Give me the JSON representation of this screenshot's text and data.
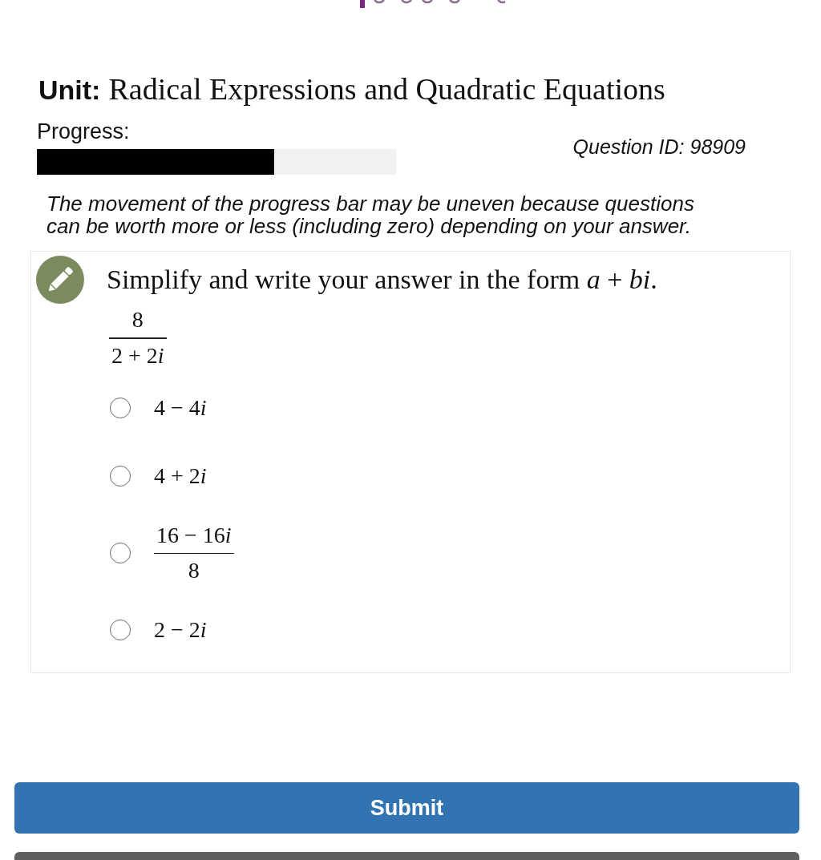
{
  "unit": {
    "label": "Unit:",
    "title": "Radical Expressions and Quadratic Equations"
  },
  "progress": {
    "label": "Progress:",
    "level": 0.66
  },
  "question_id": "Question ID: 98909",
  "note": "The movement of the progress bar may be uneven because questions can be worth more or less (including zero) depending on your answer.",
  "question": {
    "prompt": "Simplify and write your answer in the form *a* + *bi*.",
    "expression": {
      "numerator": [
        "8"
      ],
      "denominator": [
        "2 + 2",
        "*i*"
      ]
    },
    "choices": [
      {
        "kind": "text",
        "text": [
          "4 − 4",
          "*i*"
        ],
        "selected": false
      },
      {
        "kind": "text",
        "text": [
          "4 + 2",
          "*i*"
        ],
        "selected": false
      },
      {
        "kind": "fraction",
        "numerator": [
          "16 − 16",
          "*i*"
        ],
        "denominator": [
          "8"
        ],
        "selected": false
      },
      {
        "kind": "text",
        "text": [
          "2 − 2",
          "*i*"
        ],
        "selected": false
      }
    ]
  },
  "buttons": [
    {
      "kind": "primary",
      "label": "Submit"
    },
    {
      "kind": "secondary"
    }
  ]
}
